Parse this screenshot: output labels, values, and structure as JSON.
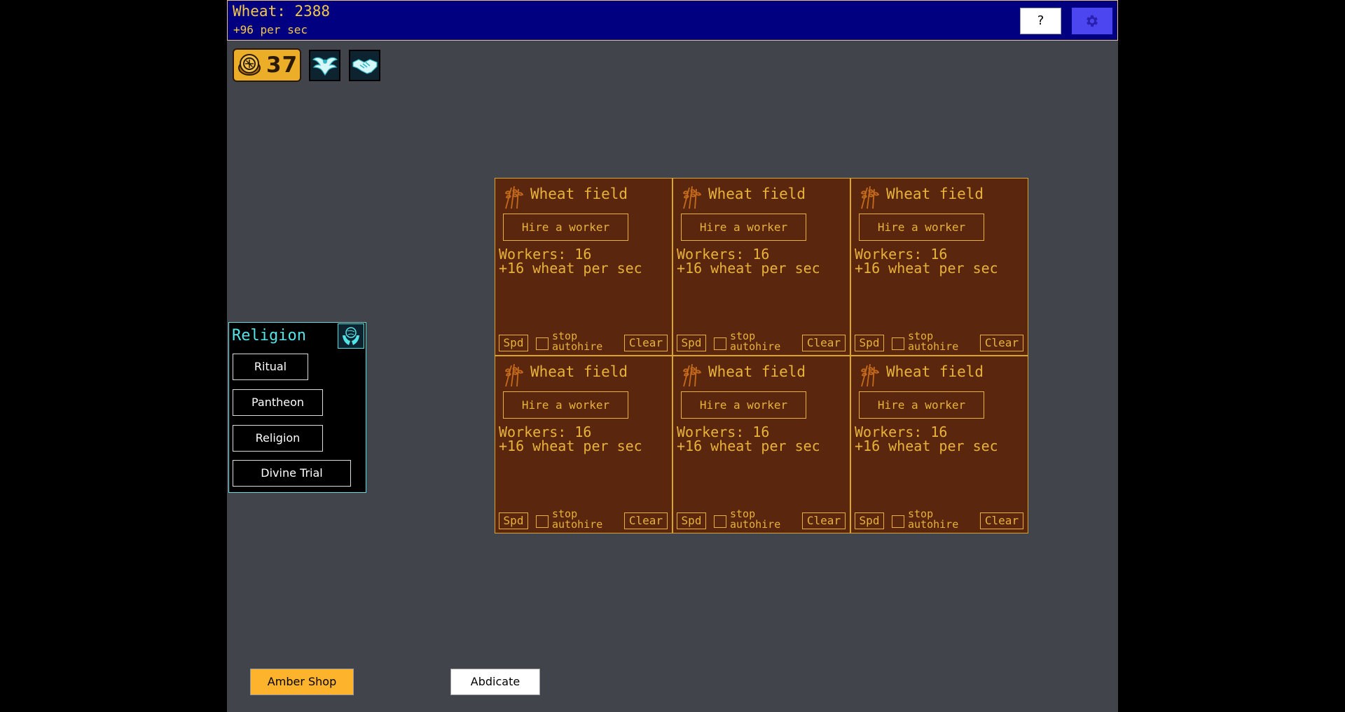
{
  "header": {
    "resource": "Wheat: 2388",
    "rate": "+96 per sec",
    "help_label": "?",
    "settings_icon": "gear-icon"
  },
  "badges": {
    "amber_count": "37",
    "amber_icon": "amber-coin-icon",
    "icons": [
      "dove-wings-icon",
      "handshake-icon"
    ]
  },
  "religion_panel": {
    "title": "Religion",
    "icon": "hands-globe-icon",
    "buttons": [
      "Ritual",
      "Pantheon",
      "Religion",
      "Divine Trial"
    ]
  },
  "fields": [
    {
      "title": "Wheat field",
      "hire_label": "Hire a worker",
      "workers": "Workers: 16",
      "rate": "+16 wheat per sec",
      "spd_label": "Spd",
      "autohire_label": [
        "stop",
        "autohire"
      ],
      "clear_label": "Clear"
    },
    {
      "title": "Wheat field",
      "hire_label": "Hire a worker",
      "workers": "Workers: 16",
      "rate": "+16 wheat per sec",
      "spd_label": "Spd",
      "autohire_label": [
        "stop",
        "autohire"
      ],
      "clear_label": "Clear"
    },
    {
      "title": "Wheat field",
      "hire_label": "Hire a worker",
      "workers": "Workers: 16",
      "rate": "+16 wheat per sec",
      "spd_label": "Spd",
      "autohire_label": [
        "stop",
        "autohire"
      ],
      "clear_label": "Clear"
    },
    {
      "title": "Wheat field",
      "hire_label": "Hire a worker",
      "workers": "Workers: 16",
      "rate": "+16 wheat per sec",
      "spd_label": "Spd",
      "autohire_label": [
        "stop",
        "autohire"
      ],
      "clear_label": "Clear"
    },
    {
      "title": "Wheat field",
      "hire_label": "Hire a worker",
      "workers": "Workers: 16",
      "rate": "+16 wheat per sec",
      "spd_label": "Spd",
      "autohire_label": [
        "stop",
        "autohire"
      ],
      "clear_label": "Clear"
    },
    {
      "title": "Wheat field",
      "hire_label": "Hire a worker",
      "workers": "Workers: 16",
      "rate": "+16 wheat per sec",
      "spd_label": "Spd",
      "autohire_label": [
        "stop",
        "autohire"
      ],
      "clear_label": "Clear"
    }
  ],
  "footer": {
    "amber_shop_label": "Amber Shop",
    "abdicate_label": "Abdicate"
  },
  "colors": {
    "header_bg": "#000080",
    "field_bg": "#5a270e",
    "field_fg": "#e8b23a",
    "accent_cyan": "#53e4e8",
    "amber": "#fdb32c",
    "settings_bg": "#4b46f0"
  }
}
